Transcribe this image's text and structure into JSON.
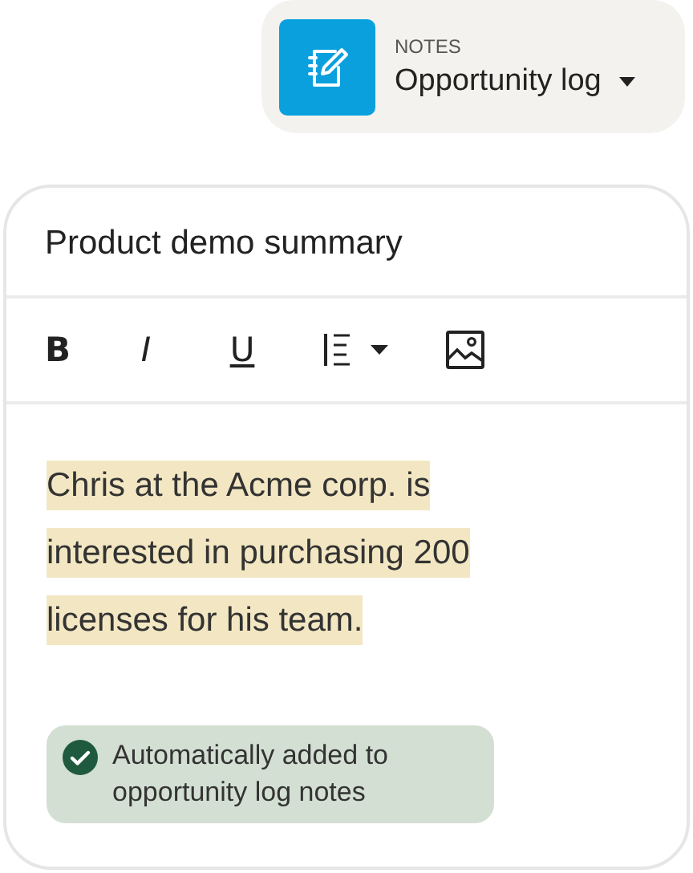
{
  "notes_selector": {
    "caption": "NOTES",
    "title": "Opportunity log"
  },
  "note": {
    "title": "Product demo summary",
    "toolbar": [
      {
        "kind": "bold",
        "label": "B"
      },
      {
        "kind": "italic",
        "label": "I"
      },
      {
        "kind": "underline",
        "label": "U"
      },
      {
        "kind": "align"
      },
      {
        "kind": "image"
      }
    ],
    "body_lines": [
      "Chris at the Acme corp. is",
      "interested in purchasing 200",
      "licenses for his team."
    ],
    "status": {
      "text": "Automatically added to opportunity log notes"
    }
  }
}
